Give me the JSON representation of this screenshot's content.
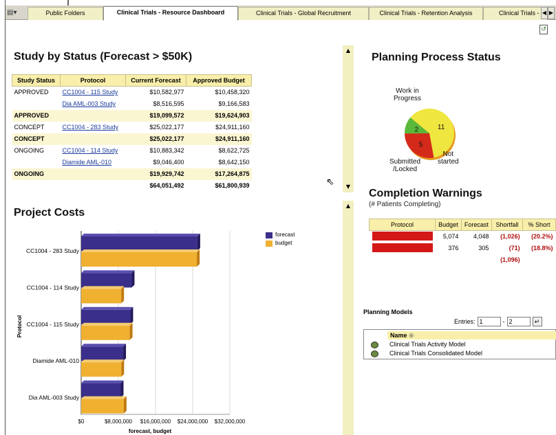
{
  "tabs": {
    "items": [
      {
        "label": "Public Folders"
      },
      {
        "label": "Clinical Trials - Resource Dashboard"
      },
      {
        "label": "Clinical Trials - Global Recruitment"
      },
      {
        "label": "Clinical Trials - Retention Analysis"
      },
      {
        "label": "Clinical Trials - Li"
      }
    ],
    "active_index": 1
  },
  "study_status": {
    "title": "Study by Status (Forecast > $50K)",
    "columns": [
      "Study Status",
      "Protocol",
      "Current Forecast",
      "Approved Budget"
    ],
    "rows": [
      {
        "status": "APPROVED",
        "protocol": "CC1004 - 115 Study",
        "forecast": "$10,582,977",
        "budget": "$10,458,320"
      },
      {
        "status": "",
        "protocol": "Dia AML-003 Study",
        "forecast": "$8,516,595",
        "budget": "$9,166,583"
      },
      {
        "status": "APPROVED",
        "protocol": "",
        "forecast": "$19,099,572",
        "budget": "$19,624,903"
      },
      {
        "status": "CONCEPT",
        "protocol": "CC1004 - 283 Study",
        "forecast": "$25,022,177",
        "budget": "$24,911,160"
      },
      {
        "status": "CONCEPT",
        "protocol": "",
        "forecast": "$25,022,177",
        "budget": "$24,911,160"
      },
      {
        "status": "ONGOING",
        "protocol": "CC1004 - 114 Study",
        "forecast": "$10,883,342",
        "budget": "$8,622,725"
      },
      {
        "status": "",
        "protocol": "Diamide AML-010",
        "forecast": "$9,046,400",
        "budget": "$8,642,150"
      },
      {
        "status": "ONGOING",
        "protocol": "",
        "forecast": "$19,929,742",
        "budget": "$17,264,875"
      },
      {
        "status": "",
        "protocol": "",
        "forecast": "$64,051,492",
        "budget": "$61,800,939"
      }
    ]
  },
  "project_costs": {
    "title": "Project Costs"
  },
  "chart_data": {
    "type": "bar",
    "orientation": "horizontal",
    "categories": [
      "CC1004 - 283 Study",
      "CC1004 - 114 Study",
      "CC1004 - 115 Study",
      "Diamide AML-010",
      "Dia AML-003 Study"
    ],
    "series": [
      {
        "name": "forecast",
        "color": "#3a2f8a",
        "values": [
          25022177,
          10883342,
          10582977,
          9046400,
          8516595
        ]
      },
      {
        "name": "budget",
        "color": "#f0b030",
        "values": [
          24911160,
          8622725,
          10458320,
          8642150,
          9166583
        ]
      }
    ],
    "xlabel": "forecast, budget",
    "ylabel": "Protocol",
    "xlim": [
      0,
      32000000
    ],
    "xticks": [
      "$0",
      "$8,000,000",
      "$16,000,000",
      "$24,000,000",
      "$32,000,000"
    ],
    "legend_position": "top-right",
    "grid": true
  },
  "planning_status": {
    "title": "Planning Process Status",
    "slices": [
      {
        "label_lines": [
          "Work in",
          "Progress"
        ],
        "value": 11,
        "color": "#f0e640"
      },
      {
        "label_lines": [
          "Not",
          "started"
        ],
        "value": 5,
        "color": "#d42a1a"
      },
      {
        "label_lines": [
          "Submitted",
          "/Locked"
        ],
        "value": 2,
        "color": "#5ab83a"
      }
    ]
  },
  "completion": {
    "title": "Completion Warnings",
    "subtitle": "(# Patients Completing)",
    "columns": [
      "Protocol",
      "Budget",
      "Forecast",
      "Shortfall",
      "% Short"
    ],
    "rows": [
      {
        "budget": "5,074",
        "forecast": "4,048",
        "shortfall": "(1,026)",
        "pct": "(20.2%)"
      },
      {
        "budget": "376",
        "forecast": "305",
        "shortfall": "(71)",
        "pct": "(18.8%)"
      }
    ],
    "total_shortfall": "(1,096)"
  },
  "planning_models": {
    "title": "Planning Models",
    "entries_label": "Entries:",
    "entries_from": "1",
    "entries_sep": "-",
    "entries_to": "2",
    "column": "Name",
    "sort_icon": "⊕",
    "items": [
      "Clinical Trials Activity Model",
      "Clinical Trials Consolidated Model"
    ]
  }
}
